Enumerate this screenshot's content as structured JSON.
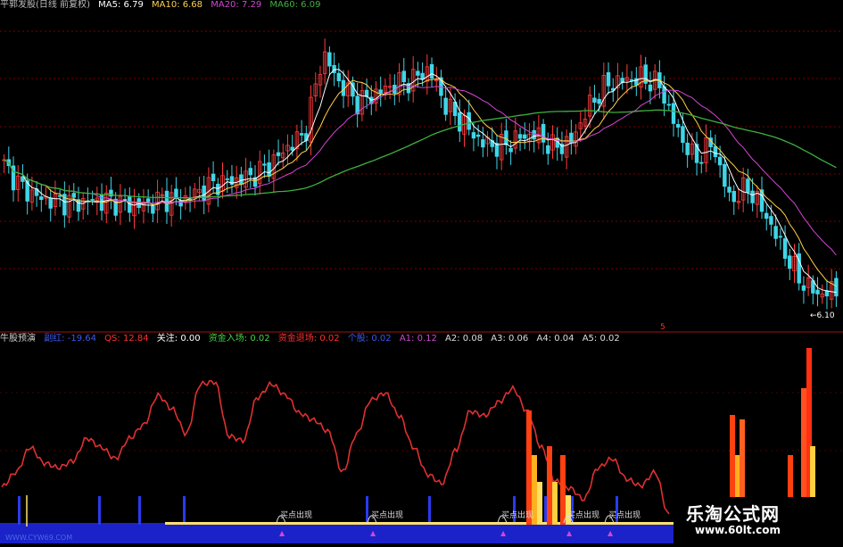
{
  "header": {
    "title": "平郭发股(日线 前复权)",
    "ma5": "MA5: 6.79",
    "ma10": "MA10: 6.68",
    "ma20": "MA20: 7.29",
    "ma60": "MA60: 6.09"
  },
  "indicator": {
    "name": "牛股预演",
    "a": "副红: -19.64",
    "b": "QS: 12.84",
    "c": "关注: 0.00",
    "d": "资金入场: 0.02",
    "e": "资金退场: 0.02",
    "f": "个股: 0.02",
    "g": "A1: 0.12",
    "h": "A2: 0.08",
    "i": "A3: 0.06",
    "j": "A4: 0.04",
    "k": "A5: 0.02"
  },
  "price_label": "6.10",
  "mid_label": "5",
  "signals": [
    "买点出现",
    "买点出现",
    "买点出现",
    "买点出现",
    "买点出现"
  ],
  "watermark": {
    "title": "乐淘公式网",
    "url": "www.60lt.com"
  },
  "bottom_site": "WWW.CYW69.COM",
  "colors": {
    "up": "#ff3b3b",
    "down": "#3fd6e8",
    "ma5": "#ffffff",
    "ma10": "#ffd24a",
    "ma20": "#d246d2",
    "ma60": "#3fb03f",
    "curve": "#e03030",
    "bg": "#000000"
  },
  "chart_data": [
    {
      "type": "line",
      "title": "平郭发股(日线 前复权)",
      "description_series": "price_close",
      "x": [
        0,
        5,
        10,
        15,
        20,
        25,
        30,
        35,
        40,
        45,
        50,
        55,
        60,
        65,
        70,
        75,
        80,
        85,
        90,
        95,
        100,
        105,
        110,
        115,
        120,
        125,
        130,
        135,
        140,
        145,
        150,
        155,
        160,
        165,
        170,
        175,
        180,
        185,
        190,
        195,
        200,
        205,
        210,
        215,
        220,
        225,
        230,
        235
      ],
      "series": [
        {
          "name": "MA5",
          "values": [
            6.79
          ]
        },
        {
          "name": "MA10",
          "values": [
            6.68
          ]
        },
        {
          "name": "MA20",
          "values": [
            7.29
          ]
        },
        {
          "name": "MA60",
          "values": [
            6.09
          ]
        }
      ],
      "closes": [
        9.1,
        8.6,
        8.35,
        8.3,
        8.25,
        8.3,
        8.3,
        8.2,
        8.2,
        8.35,
        8.3,
        8.5,
        8.7,
        8.75,
        8.85,
        9.1,
        9.5,
        9.8,
        11.6,
        10.9,
        10.5,
        10.7,
        10.9,
        11.0,
        11.25,
        10.4,
        10.0,
        9.6,
        9.5,
        9.7,
        9.8,
        9.5,
        9.6,
        10.4,
        10.9,
        11.0,
        11.05,
        10.9,
        9.9,
        9.2,
        9.6,
        8.3,
        8.6,
        8.0,
        7.2,
        6.5,
        6.2,
        6.3
      ],
      "last_label": "6.10"
    },
    {
      "type": "line",
      "title": "牛股预演",
      "x": [
        0,
        5,
        10,
        15,
        20,
        25,
        30,
        35,
        40,
        45,
        50,
        55,
        60,
        65,
        70,
        75,
        80,
        85,
        90,
        95,
        100,
        105,
        110,
        115,
        120,
        125,
        130,
        135,
        140,
        145,
        150,
        155,
        160,
        165,
        170,
        175,
        180,
        185,
        190,
        195,
        200,
        205,
        210,
        215,
        220,
        225,
        230,
        235
      ],
      "series": [
        {
          "name": "副红",
          "values": [
            5,
            18,
            40,
            26,
            22,
            28,
            48,
            40,
            30,
            48,
            60,
            86,
            74,
            52,
            96,
            98,
            50,
            46,
            84,
            96,
            86,
            70,
            64,
            54,
            18,
            52,
            82,
            88,
            68,
            40,
            16,
            8,
            38,
            72,
            68,
            80,
            92,
            72,
            40,
            10,
            4,
            -6,
            22,
            30,
            12,
            6,
            18,
            -20
          ]
        }
      ],
      "ylim": [
        -30,
        120
      ]
    }
  ]
}
